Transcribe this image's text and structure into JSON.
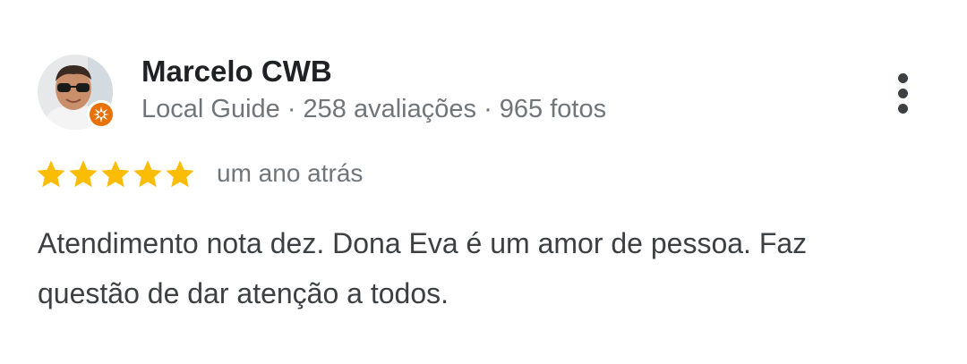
{
  "reviewer": {
    "name": "Marcelo CWB",
    "meta": "Local Guide · 258 avaliações · 965 fotos"
  },
  "review": {
    "rating": 5,
    "max_rating": 5,
    "date": "um ano atrás",
    "text_lines": [
      "Atendimento nota dez. Dona Eva é um amor de pessoa. Faz",
      "questão de dar atenção a todos."
    ]
  },
  "icons": {
    "menu": "more-vert-icon",
    "badge": "local-guide-badge-icon",
    "star": "star-icon"
  },
  "colors": {
    "star": "#fbbc04",
    "badge": "#e8710a",
    "name": "#202124",
    "secondary": "#70757a",
    "body": "#3c4043"
  }
}
